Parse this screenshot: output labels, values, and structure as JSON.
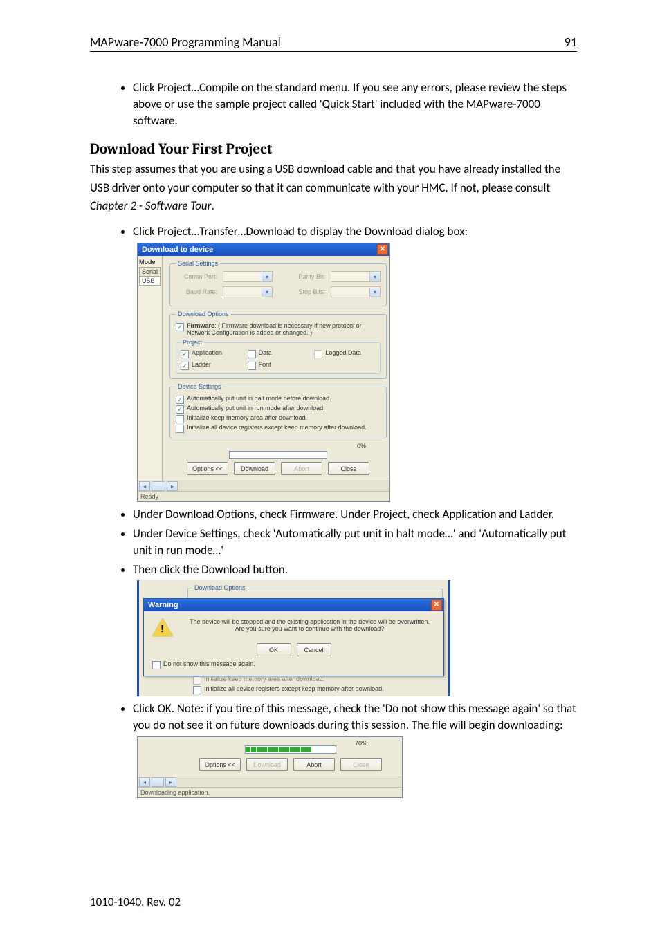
{
  "header": {
    "title": "MAPware-7000 Programming Manual",
    "pageno": "91"
  },
  "intro_bullets": [
    "Click Project…Compile on the standard menu.  If you see any errors, please review the steps above or use the sample project called 'Quick Start' included with the MAPware-7000 software."
  ],
  "section_title": "Download Your First Project",
  "para1a": "This step assumes that you are using a USB download cable and that you have already installed the USB driver onto your computer so that it can communicate with your HMC.  If not, please consult ",
  "para1b": "Chapter 2 - Software Tour",
  "para1c": ".",
  "bullets2": [
    "Click Project…Transfer…Download to display the Download dialog box:"
  ],
  "bullets3": [
    "Under Download Options, check Firmware.  Under Project, check Application and Ladder.",
    "Under Device Settings, check 'Automatically put unit in halt mode…' and 'Automatically put unit in run mode…'",
    "Then click the Download button."
  ],
  "bullets4": [
    "Click OK.  Note: if you tire of this message, check the 'Do not show this message again' so that you do not see it on future downloads during this session.  The file will begin downloading:"
  ],
  "footer": "1010-1040, Rev. 02",
  "dlg1": {
    "title": "Download to device",
    "mode_header": "Mode",
    "modes": [
      "Serial",
      "USB"
    ],
    "serial": {
      "legend": "Serial Settings",
      "comm_port": "Comm Port:",
      "baud_rate": "Baud Rate:",
      "parity": "Parity Bit:",
      "stop": "Stop Bits:"
    },
    "dlopt": {
      "legend": "Download Options",
      "firmware": "Firmware",
      "firmware_note": ": ( Firmware download is necessary if new protocol or Network Configuration is added or changed. )",
      "project_legend": "Project",
      "application": "Application",
      "ladder": "Ladder",
      "data": "Data",
      "font": "Font",
      "logged": "Logged Data"
    },
    "devset": {
      "legend": "Device Settings",
      "halt": "Automatically put unit in halt mode before download.",
      "run": "Automatically put unit in run mode after download.",
      "initkeep": "Initialize keep memory area after download.",
      "initall": "Initialize all device registers except keep memory after download."
    },
    "progress": "0%",
    "buttons": {
      "options": "Options <<",
      "download": "Download",
      "abort": "Abort",
      "close": "Close"
    },
    "status": "Ready"
  },
  "warn": {
    "title": "Warning",
    "dlopt_legend": "Download Options",
    "msg1": "The device will be stopped and the existing application in the device will be overwritten.",
    "msg2": "Are you sure you want to continue with the download?",
    "ok": "OK",
    "cancel": "Cancel",
    "dontshow": "Do not show this message again.",
    "under1": "Initialize keep memory area after download.",
    "under2": "Initialize all device registers except keep memory after download."
  },
  "prog": {
    "pct": "70%",
    "options": "Options <<",
    "download": "Download",
    "abort": "Abort",
    "close": "Close",
    "status": "Downloading application."
  }
}
